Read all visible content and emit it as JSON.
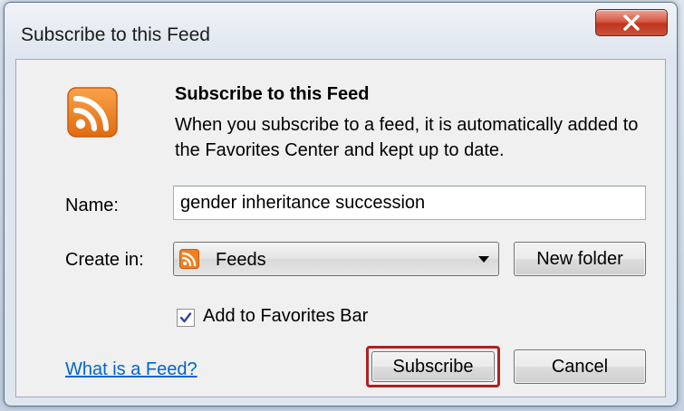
{
  "window": {
    "title": "Subscribe to this Feed",
    "close_icon": "close-x-icon"
  },
  "header": {
    "icon": "rss-feed-icon",
    "heading": "Subscribe to this Feed",
    "description": "When you subscribe to a feed, it is automatically added to the Favorites Center and kept up to date."
  },
  "form": {
    "name_label": "Name:",
    "name_value": "gender inheritance succession",
    "create_in_label": "Create in:",
    "create_in_value": "Feeds",
    "create_in_icon": "rss-feed-icon",
    "new_folder_label": "New folder",
    "favorites_bar_label": "Add to Favorites Bar",
    "favorites_bar_checked": true
  },
  "footer": {
    "help_link": "What is a Feed?",
    "subscribe_label": "Subscribe",
    "cancel_label": "Cancel"
  },
  "colors": {
    "rss_orange": "#f07f1e",
    "link_blue": "#0066cc",
    "highlight_red": "#b02020",
    "close_red": "#c9533a"
  }
}
